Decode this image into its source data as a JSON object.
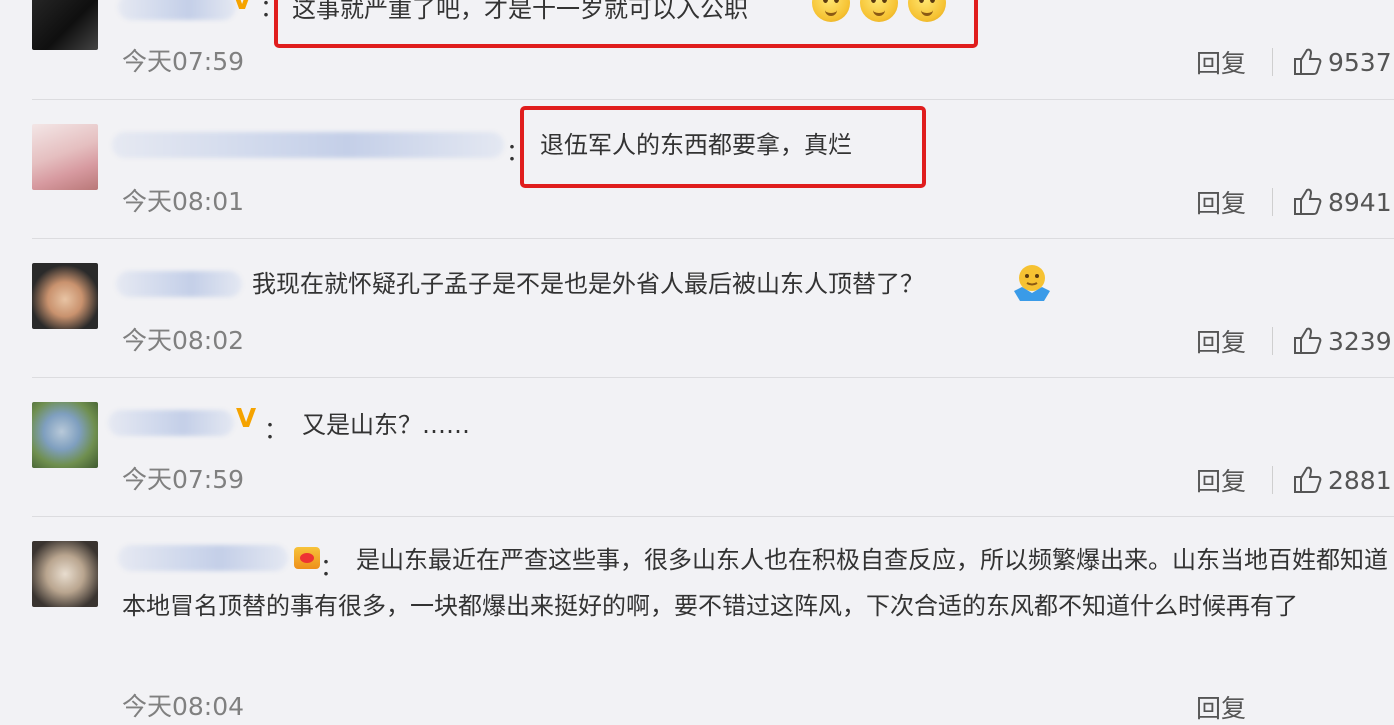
{
  "comments": [
    {
      "text": "这事就严重了吧，才是十一岁就可以入公职",
      "time": "今天07:59",
      "reply_label": "回复",
      "likes": "9537",
      "badge": "V"
    },
    {
      "text": "退伍军人的东西都要拿，真烂",
      "time": "今天08:01",
      "reply_label": "回复",
      "likes": "8941"
    },
    {
      "text": "我现在就怀疑孔子孟子是不是也是外省人最后被山东人顶替了？",
      "time": "今天08:02",
      "reply_label": "回复",
      "likes": "3239"
    },
    {
      "text": "又是山东？……",
      "time": "今天07:59",
      "reply_label": "回复",
      "likes": "2881",
      "badge": "V"
    },
    {
      "text": "是山东最近在严查这些事，很多山东人也在积极自查反应，所以频繁爆出来。山东当地百姓都知道本地冒名顶替的事有很多，一块都爆出来挺好的啊，要不错过这阵风，下次合适的东风都不知道什么时候再有了",
      "time": "今天08:04",
      "reply_label": "回复",
      "likes": ""
    }
  ],
  "colors": {
    "background": "#f2f2f5",
    "highlight_box": "#e01d1d",
    "verified_badge": "#f5a300",
    "timestamp": "#808080"
  }
}
